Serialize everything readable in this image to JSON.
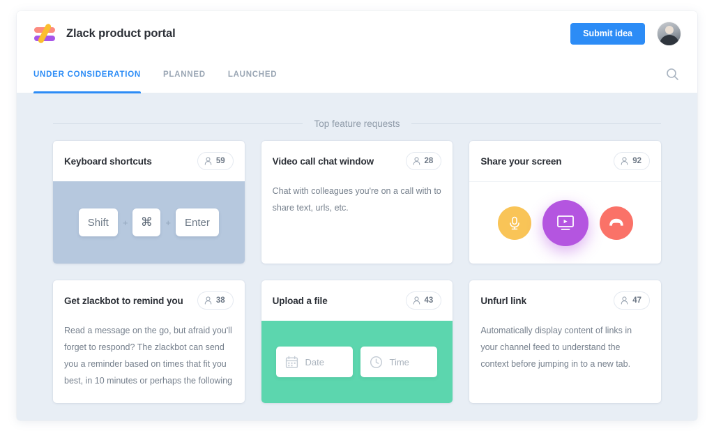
{
  "header": {
    "logo_icon": "zlack-logo-icon",
    "title": "Zlack product portal",
    "submit_label": "Submit idea",
    "avatar_icon": "user-avatar"
  },
  "tabs": {
    "items": [
      {
        "label": "UNDER CONSIDERATION",
        "active": true
      },
      {
        "label": "PLANNED",
        "active": false
      },
      {
        "label": "LAUNCHED",
        "active": false
      }
    ],
    "search_icon": "search-icon"
  },
  "section": {
    "title": "Top feature requests"
  },
  "cards": [
    {
      "title": "Keyboard shortcuts",
      "votes": "59",
      "vote_icon": "person-icon",
      "media": "keyboard",
      "keys": [
        "Shift",
        "⌘",
        "Enter"
      ],
      "plus": "+",
      "description": ""
    },
    {
      "title": "Video call chat window",
      "votes": "28",
      "vote_icon": "person-icon",
      "media": "text",
      "description": "Chat with colleagues you're on a call with to share text, urls, etc."
    },
    {
      "title": "Share your screen",
      "votes": "92",
      "vote_icon": "person-icon",
      "media": "call-buttons",
      "buttons": [
        {
          "name": "microphone-button",
          "color": "#F9C457"
        },
        {
          "name": "screen-share-button",
          "color": "#B455E0"
        },
        {
          "name": "hang-up-button",
          "color": "#FA7268"
        }
      ],
      "description": ""
    },
    {
      "title": "Get zlackbot to remind you",
      "votes": "38",
      "vote_icon": "person-icon",
      "media": "text",
      "description": "Read a message on the go, but afraid you'll forget to respond? The zlackbot can send you a reminder based on times that fit you best, in 10 minutes or perhaps the following"
    },
    {
      "title": "Upload a file",
      "votes": "43",
      "vote_icon": "person-icon",
      "media": "date-time",
      "date_label": "Date",
      "time_label": "Time",
      "description": ""
    },
    {
      "title": "Unfurl link",
      "votes": "47",
      "vote_icon": "person-icon",
      "media": "text",
      "description": "Automatically display content of links in your channel feed to understand the context before jumping in to a new tab."
    }
  ],
  "colors": {
    "accent": "#2C8CF6",
    "page_bg": "#E8EEF5",
    "keyboard_panel": "#B6C8DE",
    "green_panel": "#5CD6AE",
    "logo_pink": "#FC8B80",
    "logo_purple": "#A855E8",
    "logo_yellow": "#FBBE2E"
  }
}
